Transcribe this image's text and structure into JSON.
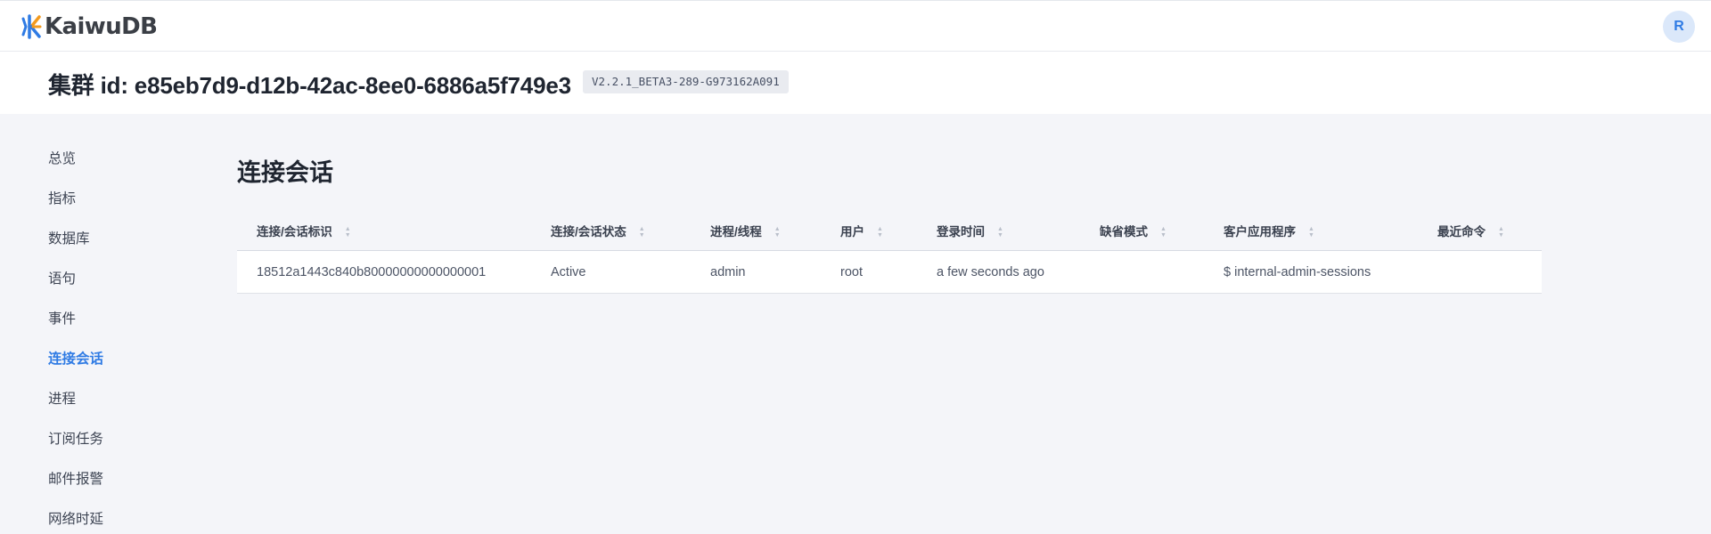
{
  "brand": {
    "name": "KaiwuDB",
    "logo_colors": [
      "#2f7be4",
      "#f39a1e"
    ]
  },
  "user": {
    "avatar_initial": "R"
  },
  "cluster": {
    "title": "集群 id: e85eb7d9-d12b-42ac-8ee0-6886a5f749e3",
    "version": "V2.2.1_BETA3-289-G973162A091"
  },
  "sidebar": {
    "items": [
      {
        "label": "总览",
        "active": false
      },
      {
        "label": "指标",
        "active": false
      },
      {
        "label": "数据库",
        "active": false
      },
      {
        "label": "语句",
        "active": false
      },
      {
        "label": "事件",
        "active": false
      },
      {
        "label": "连接会话",
        "active": true
      },
      {
        "label": "进程",
        "active": false
      },
      {
        "label": "订阅任务",
        "active": false
      },
      {
        "label": "邮件报警",
        "active": false
      },
      {
        "label": "网络时延",
        "active": false
      }
    ]
  },
  "page": {
    "title": "连接会话"
  },
  "table": {
    "columns": [
      "连接/会话标识",
      "连接/会话状态",
      "进程/线程",
      "用户",
      "登录时间",
      "缺省模式",
      "客户应用程序",
      "最近命令"
    ],
    "rows": [
      [
        "18512a1443c840b80000000000000001",
        "Active",
        "admin",
        "root",
        "a few seconds ago",
        "",
        "$ internal-admin-sessions",
        ""
      ]
    ]
  },
  "colors": {
    "accent": "#2f7be4",
    "page_bg": "#f4f5f9"
  }
}
